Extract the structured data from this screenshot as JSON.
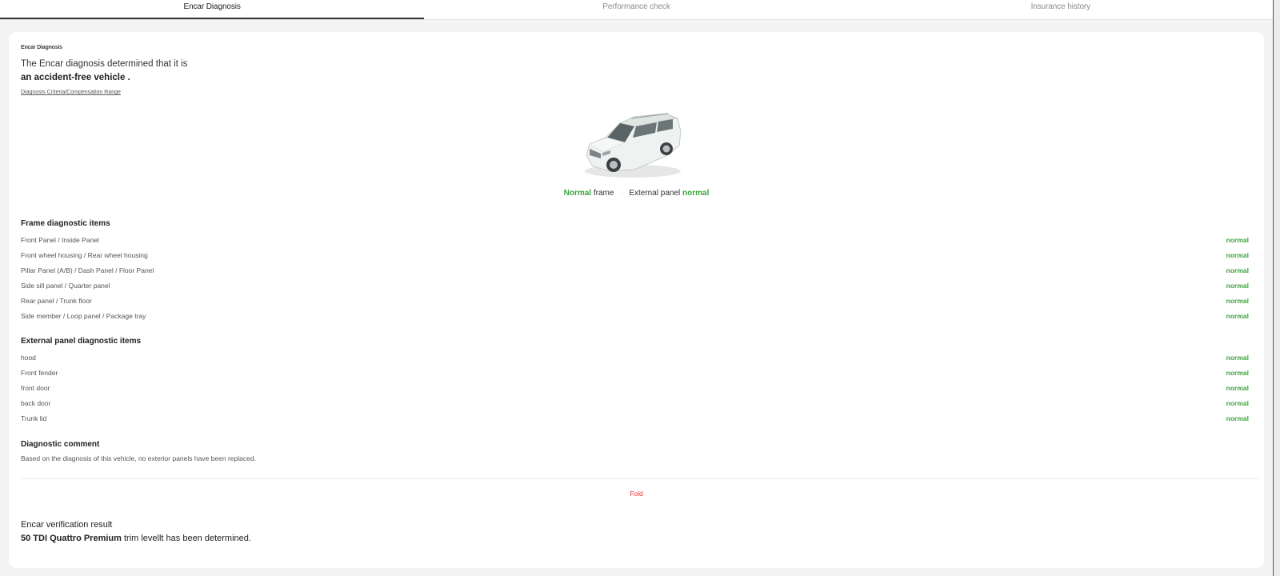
{
  "tabs": [
    {
      "label": "Encar Diagnosis",
      "active": true
    },
    {
      "label": "Performance check",
      "active": false
    },
    {
      "label": "Insurance history",
      "active": false
    }
  ],
  "diagnosis": {
    "section_label": "Encar Diagnosis",
    "headline_line1": "The Encar diagnosis determined that it is",
    "headline_line2": "an accident-free vehicle .",
    "criteria_link": "Diagnosis Criteria/Compensation Range",
    "car_icon": "suv-car-image",
    "summary": {
      "frame_status": "Normal",
      "frame_label": "frame",
      "panel_label": "External panel",
      "panel_status": "normal"
    }
  },
  "frame_items": {
    "title": "Frame diagnostic items",
    "rows": [
      {
        "label": "Front Panel / Inside Panel",
        "status": "normal"
      },
      {
        "label": "Front wheel housing / Rear wheel housing",
        "status": "normal"
      },
      {
        "label": "Pillar Panel (A/B) / Dash Panel / Floor Panel",
        "status": "normal"
      },
      {
        "label": "Side sill panel / Quarter panel",
        "status": "normal"
      },
      {
        "label": "Rear panel / Trunk floor",
        "status": "normal"
      },
      {
        "label": "Side member / Loop panel / Package tray",
        "status": "normal"
      }
    ]
  },
  "panel_items": {
    "title": "External panel diagnostic items",
    "rows": [
      {
        "label": "hood",
        "status": "normal"
      },
      {
        "label": "Front fender",
        "status": "normal"
      },
      {
        "label": "front door",
        "status": "normal"
      },
      {
        "label": "back door",
        "status": "normal"
      },
      {
        "label": "Trunk lid",
        "status": "normal"
      }
    ]
  },
  "comment": {
    "title": "Diagnostic comment",
    "text": "Based on the diagnosis of this vehicle, no exterior panels have been replaced."
  },
  "fold_label": "Fold",
  "verification": {
    "line1": "Encar verification result",
    "trim_bold": "50 TDI Quattro Premium",
    "trim_rest": " trim levellt has been determined."
  },
  "colors": {
    "status_green": "#3aa53a",
    "fold_red": "#e53030"
  }
}
